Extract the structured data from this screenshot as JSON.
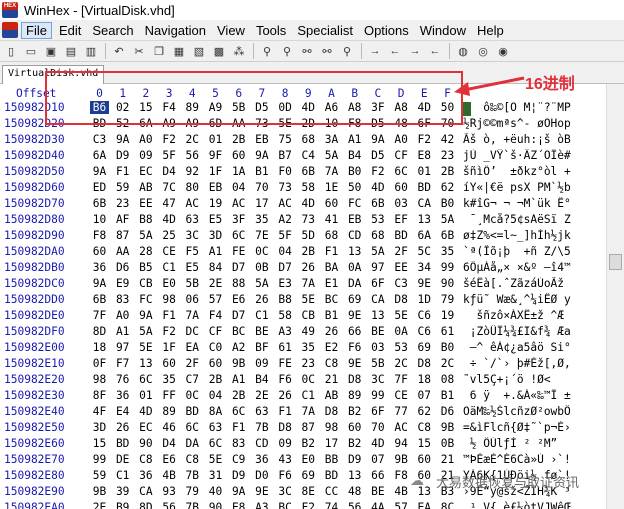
{
  "window": {
    "title": "WinHex - [VirtualDisk.vhd]"
  },
  "menu": [
    "File",
    "Edit",
    "Search",
    "Navigation",
    "View",
    "Tools",
    "Specialist",
    "Options",
    "Window",
    "Help"
  ],
  "tab": {
    "label": "VirtualDisk.vhd"
  },
  "editor": {
    "offset_label": "Offset",
    "hex_columns": [
      "0",
      "1",
      "2",
      "3",
      "4",
      "5",
      "6",
      "7",
      "8",
      "9",
      "A",
      "B",
      "C",
      "D",
      "E",
      "F"
    ],
    "rows": [
      {
        "offset": "150982D10",
        "bytes": [
          "B6",
          "02",
          "15",
          "F4",
          "89",
          "A9",
          "5B",
          "D5",
          "0D",
          "4D",
          "A6",
          "A8",
          "3F",
          "A8",
          "4D",
          "50"
        ],
        "ascii": "¶  ô‰©[Õ M¦¨?¨MP"
      },
      {
        "offset": "150982D20",
        "bytes": [
          "BD",
          "52",
          "6A",
          "A9",
          "A9",
          "6D",
          "AA",
          "73",
          "5E",
          "2D",
          "10",
          "F8",
          "D5",
          "48",
          "6F",
          "70"
        ],
        "ascii": "½Rj©©mªs^- øÕHop"
      },
      {
        "offset": "150982D30",
        "bytes": [
          "C3",
          "9A",
          "A0",
          "F2",
          "2C",
          "01",
          "2B",
          "EB",
          "75",
          "68",
          "3A",
          "A1",
          "9A",
          "A0",
          "F2",
          "42"
        ],
        "ascii": "Ãš ò, +ëuh:¡š òB"
      },
      {
        "offset": "150982D40",
        "bytes": [
          "6A",
          "D9",
          "09",
          "5F",
          "56",
          "9F",
          "60",
          "9A",
          "B7",
          "C4",
          "5A",
          "B4",
          "D5",
          "CF",
          "E8",
          "23"
        ],
        "ascii": "jÙ _VŸ`š·ÄZ´ÕÏè#"
      },
      {
        "offset": "150982D50",
        "bytes": [
          "9A",
          "F1",
          "EC",
          "D4",
          "92",
          "1F",
          "1A",
          "B1",
          "F0",
          "6B",
          "7A",
          "B0",
          "F2",
          "6C",
          "01",
          "2B"
        ],
        "ascii": "šñìÔ’  ±ðkz°òl +"
      },
      {
        "offset": "150982D60",
        "bytes": [
          "ED",
          "59",
          "AB",
          "7C",
          "80",
          "EB",
          "04",
          "70",
          "73",
          "58",
          "1E",
          "50",
          "4D",
          "60",
          "BD",
          "62"
        ],
        "ascii": "íY«|€ë psX PM`½b"
      },
      {
        "offset": "150982D70",
        "bytes": [
          "6B",
          "23",
          "EE",
          "47",
          "AC",
          "19",
          "AC",
          "17",
          "AC",
          "4D",
          "60",
          "FC",
          "6B",
          "03",
          "CA",
          "B0"
        ],
        "ascii": "k#îG¬ ¬ ¬M`ük Ê°"
      },
      {
        "offset": "150982D80",
        "bytes": [
          "10",
          "AF",
          "B8",
          "4D",
          "63",
          "E5",
          "3F",
          "35",
          "A2",
          "73",
          "41",
          "EB",
          "53",
          "EF",
          "13",
          "5A"
        ],
        "ascii": " ¯¸Mcå?5¢sAëSï Z"
      },
      {
        "offset": "150982D90",
        "bytes": [
          "F8",
          "87",
          "5A",
          "25",
          "3C",
          "3D",
          "6C",
          "7E",
          "5F",
          "5D",
          "68",
          "CD",
          "68",
          "BD",
          "6A",
          "6B"
        ],
        "ascii": "ø‡Z%<=l~_]hÍh½jk"
      },
      {
        "offset": "150982DA0",
        "bytes": [
          "60",
          "AA",
          "28",
          "CE",
          "F5",
          "A1",
          "FE",
          "0C",
          "04",
          "2B",
          "F1",
          "13",
          "5A",
          "2F",
          "5C",
          "35"
        ],
        "ascii": "`ª(Îõ¡þ  +ñ Z/\\5"
      },
      {
        "offset": "150982DB0",
        "bytes": [
          "36",
          "D6",
          "B5",
          "C1",
          "E5",
          "84",
          "D7",
          "0B",
          "D7",
          "26",
          "BA",
          "0A",
          "97",
          "EE",
          "34",
          "99"
        ],
        "ascii": "6ÖµÁå„× ×&º —î4™"
      },
      {
        "offset": "150982DC0",
        "bytes": [
          "9A",
          "E9",
          "CB",
          "E0",
          "5B",
          "2E",
          "88",
          "5A",
          "E3",
          "7A",
          "E1",
          "DA",
          "6F",
          "C3",
          "9E",
          "90"
        ],
        "ascii": "šéËà[.ˆZãzáÚoÃž "
      },
      {
        "offset": "150982DD0",
        "bytes": [
          "6B",
          "83",
          "FC",
          "98",
          "06",
          "57",
          "E6",
          "26",
          "B8",
          "5E",
          "BC",
          "69",
          "CA",
          "D8",
          "1D",
          "79"
        ],
        "ascii": "kƒü˜ Wæ&¸^¼iÊØ y"
      },
      {
        "offset": "150982DE0",
        "bytes": [
          "7F",
          "A0",
          "9A",
          "F1",
          "7A",
          "F4",
          "D7",
          "C1",
          "58",
          "CB",
          "B1",
          "9E",
          "13",
          "5E",
          "C6",
          "19"
        ],
        "ascii": "  šñzô×ÁXË±ž ^Æ "
      },
      {
        "offset": "150982DF0",
        "bytes": [
          "8D",
          "A1",
          "5A",
          "F2",
          "DC",
          "CF",
          "BC",
          "BE",
          "A3",
          "49",
          "26",
          "66",
          "BE",
          "0A",
          "C6",
          "61"
        ],
        "ascii": " ¡ZòÜÏ¼¾£I&f¾ Æa"
      },
      {
        "offset": "150982E00",
        "bytes": [
          "18",
          "97",
          "5E",
          "1F",
          "EA",
          "C0",
          "A2",
          "BF",
          "61",
          "35",
          "E2",
          "F6",
          "03",
          "53",
          "69",
          "B0"
        ],
        "ascii": " —^ êÀ¢¿a5âö Si°"
      },
      {
        "offset": "150982E10",
        "bytes": [
          "0F",
          "F7",
          "13",
          "60",
          "2F",
          "60",
          "9B",
          "09",
          "FE",
          "23",
          "C8",
          "9E",
          "5B",
          "2C",
          "D8",
          "2C"
        ],
        "ascii": " ÷ `/`› þ#Èž[,Ø,"
      },
      {
        "offset": "150982E20",
        "bytes": [
          "98",
          "76",
          "6C",
          "35",
          "C7",
          "2B",
          "A1",
          "B4",
          "F6",
          "0C",
          "21",
          "D8",
          "3C",
          "7F",
          "18",
          "08"
        ],
        "ascii": "˜vl5Ç+¡´ö !Ø<   "
      },
      {
        "offset": "150982E30",
        "bytes": [
          "8F",
          "36",
          "01",
          "FF",
          "0C",
          "04",
          "2B",
          "2E",
          "26",
          "C1",
          "AB",
          "89",
          "99",
          "CE",
          "07",
          "B1"
        ],
        "ascii": " 6 ÿ  +.&Á«‰™Î ±"
      },
      {
        "offset": "150982E40",
        "bytes": [
          "4F",
          "E4",
          "4D",
          "89",
          "BD",
          "8A",
          "6C",
          "63",
          "F1",
          "7A",
          "D8",
          "B2",
          "6F",
          "77",
          "62",
          "D6"
        ],
        "ascii": "OäM‰½ŠlcñzØ²owbÖ"
      },
      {
        "offset": "150982E50",
        "bytes": [
          "3D",
          "26",
          "EC",
          "46",
          "6C",
          "63",
          "F1",
          "7B",
          "D8",
          "87",
          "98",
          "60",
          "70",
          "AC",
          "C8",
          "9B"
        ],
        "ascii": "=&ìFlcñ{Ø‡˜`p¬È›"
      },
      {
        "offset": "150982E60",
        "bytes": [
          "15",
          "BD",
          "90",
          "D4",
          "DA",
          "6C",
          "83",
          "CD",
          "09",
          "B2",
          "17",
          "B2",
          "4D",
          "94",
          "15",
          "0B"
        ],
        "ascii": " ½ ÔÚlƒÍ ² ²M”  "
      },
      {
        "offset": "150982E70",
        "bytes": [
          "99",
          "DE",
          "C8",
          "E6",
          "C8",
          "5E",
          "C9",
          "36",
          "43",
          "E0",
          "BB",
          "D9",
          "07",
          "9B",
          "60",
          "21"
        ],
        "ascii": "™ÞÈæÈ^É6Cà»Ù ›`!"
      },
      {
        "offset": "150982E80",
        "bytes": [
          "59",
          "C1",
          "36",
          "4B",
          "7B",
          "31",
          "D9",
          "D0",
          "F6",
          "69",
          "BD",
          "13",
          "66",
          "F8",
          "60",
          "21"
        ],
        "ascii": "YÁ6K{1ÙÐöi½ fø`!"
      },
      {
        "offset": "150982E90",
        "bytes": [
          "9B",
          "39",
          "CA",
          "93",
          "79",
          "40",
          "9A",
          "9E",
          "3C",
          "8E",
          "CC",
          "48",
          "BE",
          "4B",
          "13",
          "B3"
        ],
        "ascii": "›9Ê“y@šž<ŽÌH¾K ³"
      },
      {
        "offset": "150982EA0",
        "bytes": [
          "2E",
          "B9",
          "8D",
          "56",
          "7B",
          "90",
          "E8",
          "A3",
          "BC",
          "F2",
          "74",
          "56",
          "4A",
          "57",
          "EA",
          "8C"
        ],
        "ascii": ".¹ V{ è£¼òtVJWêŒ"
      }
    ]
  },
  "annotation": {
    "label": "16进制"
  },
  "watermark": {
    "text": "大易数据恢复与取证资讯"
  }
}
